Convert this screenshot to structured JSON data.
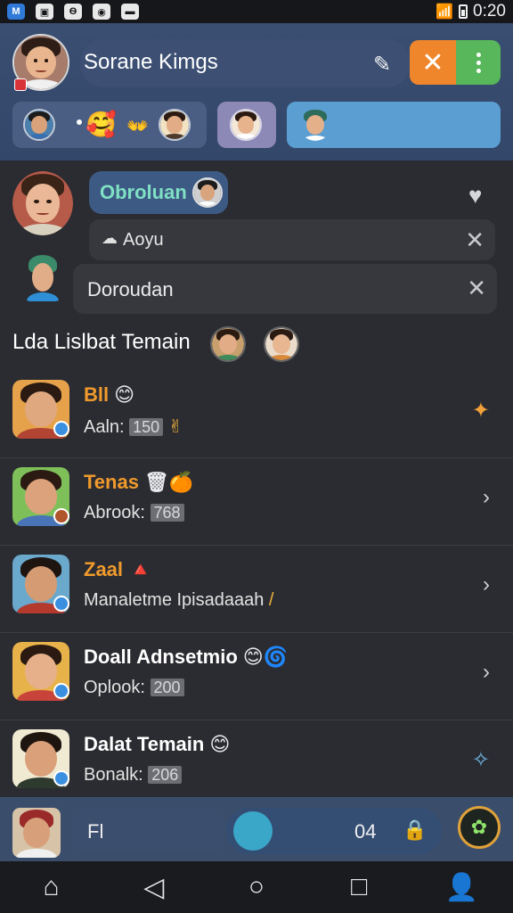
{
  "status_bar": {
    "icons": [
      "facebook-icon",
      "message-icon",
      "shield-icon",
      "camera-icon",
      "gallery-icon"
    ],
    "glyphs": [
      "M",
      "▣",
      "Ѳ",
      "◉",
      "▬"
    ],
    "signal": "▾",
    "time": "0:20"
  },
  "header": {
    "title": "Sorane Kimgs",
    "edit_glyph": "✎",
    "close_glyph": "✕"
  },
  "stories": {
    "emoji_1": "🥰",
    "emoji_2": "👐"
  },
  "main": {
    "chip_label": "Obroluan",
    "search_value": "Aoyu",
    "search_glyph": "☁",
    "second_value": "Doroudan",
    "close_glyph": "✕",
    "heart_glyph": "♥",
    "section_title": "Lda Lislbat Temain"
  },
  "list": [
    {
      "name": "Bll",
      "name_color": "#f09a2c",
      "deco": "😊",
      "meta_label": "Aaln:",
      "meta_num": "150",
      "meta_suffix": "✌",
      "trail": "✦"
    },
    {
      "name": "Tenas",
      "name_color": "#f09a2c",
      "deco": "🗑🍊",
      "meta_label": "Abrook:",
      "meta_num": "768",
      "meta_suffix": "",
      "trail": "›"
    },
    {
      "name": "Zaal",
      "name_color": "#f09a2c",
      "deco": "🔺",
      "meta_label": "Manaletme Ipisadaaah",
      "meta_num": "",
      "meta_suffix": "/",
      "trail": "›"
    },
    {
      "name": "Doall Adnsetmio",
      "name_color": "#ffffff",
      "deco": "😊🌀",
      "meta_label": "Oplook:",
      "meta_num": "200",
      "meta_suffix": "",
      "trail": "›"
    },
    {
      "name": "Dalat Temain",
      "name_color": "#ffffff",
      "deco": "😊",
      "meta_label": "Bonalk:",
      "meta_num": "206",
      "meta_suffix": "",
      "trail": "✧"
    }
  ],
  "bottom": {
    "input_text": "Fl",
    "count": "04",
    "lock_glyph": "🔒",
    "action_glyph": "✿"
  },
  "nav": {
    "home": "⌂",
    "back": "◁",
    "circle": "○",
    "square": "□",
    "profile": "👤"
  }
}
